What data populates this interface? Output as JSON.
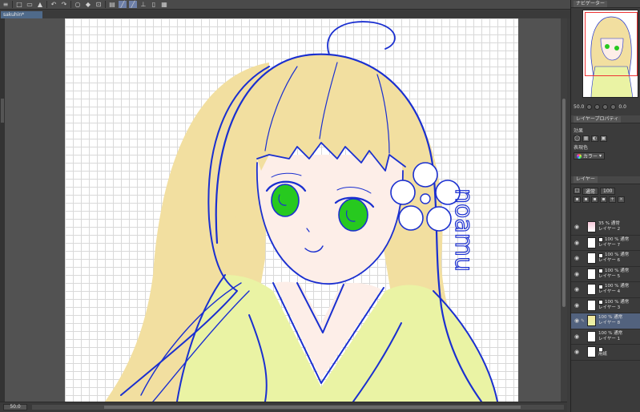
{
  "toolbar": {
    "icons": [
      "menu-icon",
      "new-icon",
      "open-icon",
      "save-icon",
      "undo-icon",
      "redo-icon",
      "circle-icon",
      "fill-icon",
      "transform-icon",
      "ruler-icon",
      "pen-tool-icon",
      "marker-icon",
      "layer-icon",
      "view-icon"
    ]
  },
  "document": {
    "tab_title": "sakuhin*"
  },
  "canvas": {
    "signature": "noamu",
    "colors": {
      "line": "#1a2fd0",
      "hair": "#f2dfa0",
      "skin": "#fdeee8",
      "kimono": "#eaf3a4",
      "eye": "#27c91f"
    }
  },
  "status": {
    "zoom": "50.0"
  },
  "navigator": {
    "tabs": [
      "ナビゲーター"
    ],
    "zoom_value": "50.0",
    "rotate_value": "0.0"
  },
  "layer_property": {
    "tab": "レイヤープロパティ",
    "effect_label": "効果",
    "express_color_label": "表現色",
    "express_color_value": "カラー"
  },
  "layers_panel": {
    "tab": "レイヤー",
    "blend_mode": "通常",
    "opacity": "100"
  },
  "layers": [
    {
      "name": "レイヤー 2",
      "mode": "35 % 通常",
      "thumb": "pink",
      "mask": false,
      "selected": false
    },
    {
      "name": "レイヤー 7",
      "mode": "100 % 通常",
      "thumb": "white",
      "mask": true,
      "selected": false
    },
    {
      "name": "レイヤー 6",
      "mode": "100 % 通常",
      "thumb": "white",
      "mask": true,
      "selected": false
    },
    {
      "name": "レイヤー 5",
      "mode": "100 % 通常",
      "thumb": "white",
      "mask": true,
      "selected": false
    },
    {
      "name": "レイヤー 4",
      "mode": "100 % 通常",
      "thumb": "white",
      "mask": true,
      "selected": false
    },
    {
      "name": "レイヤー 3",
      "mode": "100 % 通常",
      "thumb": "white",
      "mask": true,
      "selected": false
    },
    {
      "name": "レイヤー 8",
      "mode": "100 % 通常",
      "thumb": "yellow",
      "mask": false,
      "selected": true
    },
    {
      "name": "レイヤー 1",
      "mode": "100 % 通常",
      "thumb": "white",
      "mask": false,
      "selected": false
    },
    {
      "name": "用紙",
      "mode": "",
      "thumb": "white",
      "mask": true,
      "selected": false
    }
  ]
}
